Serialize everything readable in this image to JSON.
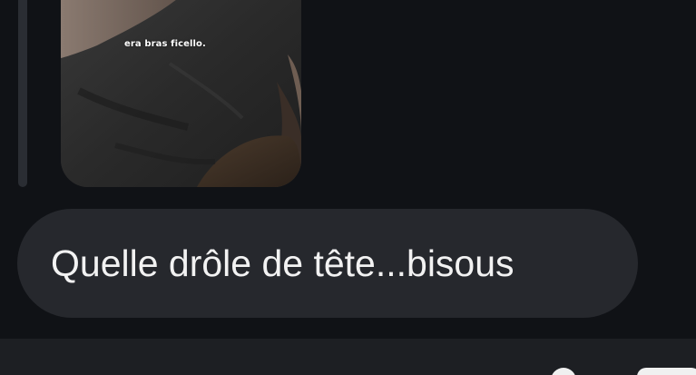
{
  "conversation": {
    "shared_photo": {
      "caption": "era bras ficello."
    },
    "message": {
      "text": "Quelle drôle de tête...bisous"
    }
  },
  "composer": {
    "icons": [
      "camera-icon",
      "send-icon"
    ]
  },
  "colors": {
    "background": "#101216",
    "bubble": "#26282d",
    "text": "#f2f2f2",
    "composer_bar": "#1d1f23"
  }
}
